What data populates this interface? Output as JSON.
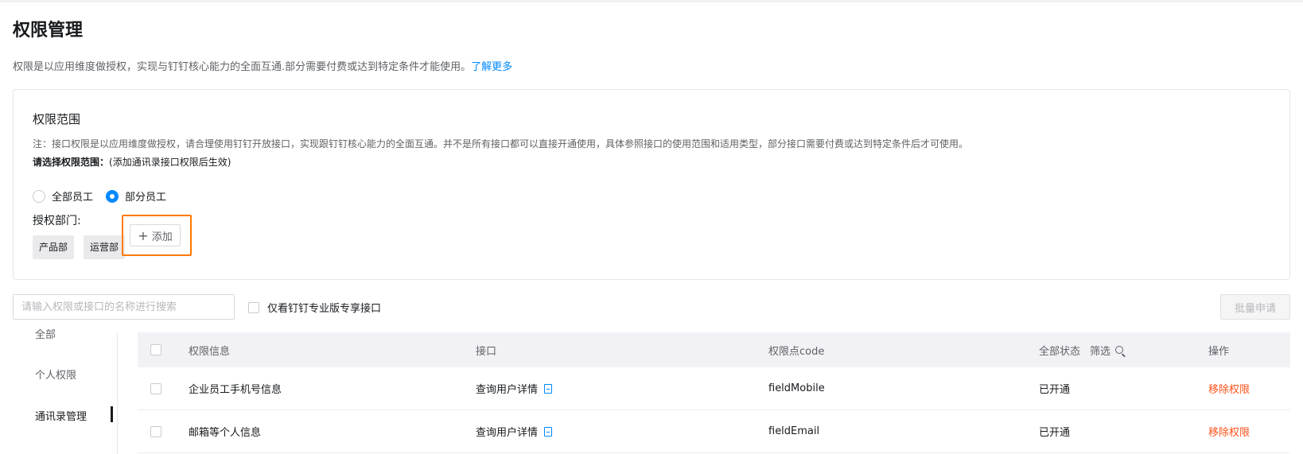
{
  "page": {
    "title": "权限管理",
    "intro": "权限是以应用维度做授权，实现与钉钉核心能力的全面互通.部分需要付费或达到特定条件才能使用。",
    "learn_more": "了解更多"
  },
  "scope": {
    "title": "权限范围",
    "note": "注：接口权限是以应用维度做授权，请合理使用钉钉开放接口，实现跟钉钉核心能力的全面互通。并不是所有接口都可以直接开通使用，具体参照接口的使用范围和适用类型，部分接口需要付费或达到特定条件后才可使用。",
    "choose_label": "请选择权限范围：",
    "choose_hint": "(添加通讯录接口权限后生效)",
    "radio_all": "全部员工",
    "radio_partial": "部分员工",
    "selected": "部分员工",
    "dept_label": "授权部门:",
    "departments": [
      "产品部",
      "运营部"
    ],
    "add_label": "添加"
  },
  "toolbar": {
    "search_placeholder": "请输入权限或接口的名称进行搜索",
    "pro_only_label": "仅看钉钉专业版专享接口",
    "batch_label": "批量申请"
  },
  "nav": {
    "items": [
      "全部",
      "个人权限",
      "通讯录管理"
    ],
    "active": "通讯录管理"
  },
  "table": {
    "headers": {
      "info": "权限信息",
      "api": "接口",
      "code": "权限点code",
      "status": "全部状态",
      "filter": "筛选",
      "op": "操作"
    },
    "rows": [
      {
        "info": "企业员工手机号信息",
        "api": "查询用户详情",
        "code": "fieldMobile",
        "status": "已开通",
        "op": "移除权限"
      },
      {
        "info": "邮箱等个人信息",
        "api": "查询用户详情",
        "code": "fieldEmail",
        "status": "已开通",
        "op": "移除权限"
      }
    ]
  },
  "colors": {
    "accent": "#0089ff",
    "danger": "#ff5219",
    "highlight": "#ff7a00"
  }
}
